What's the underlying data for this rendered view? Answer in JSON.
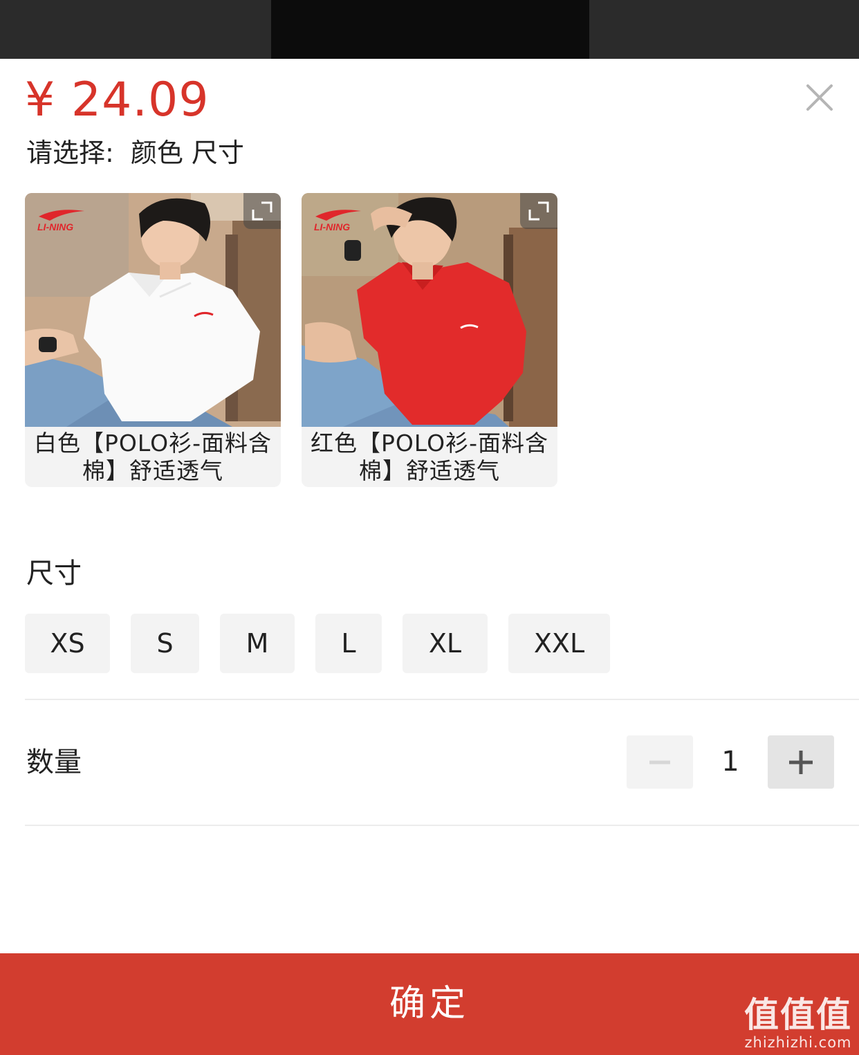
{
  "header": {
    "price": "¥ 24.09"
  },
  "prompt": {
    "label": "请选择:",
    "options": [
      "颜色",
      "尺寸"
    ]
  },
  "colors": [
    {
      "caption": "白色【POLO衫-面料含棉】舒适透气",
      "shirt_color": "#ffffff",
      "logo_text": "LI-NING"
    },
    {
      "caption": "红色【POLO衫-面料含棉】舒适透气",
      "shirt_color": "#e22b2b",
      "logo_text": "LI-NING"
    }
  ],
  "size": {
    "label": "尺寸",
    "options": [
      "XS",
      "S",
      "M",
      "L",
      "XL",
      "XXL"
    ]
  },
  "quantity": {
    "label": "数量",
    "value": "1"
  },
  "confirm": {
    "label": "确定"
  },
  "watermark": {
    "title": "值值值",
    "url": "zhizhizhi.com"
  },
  "theme": {
    "accent": "#d23d2f",
    "price_color": "#d7342a"
  }
}
